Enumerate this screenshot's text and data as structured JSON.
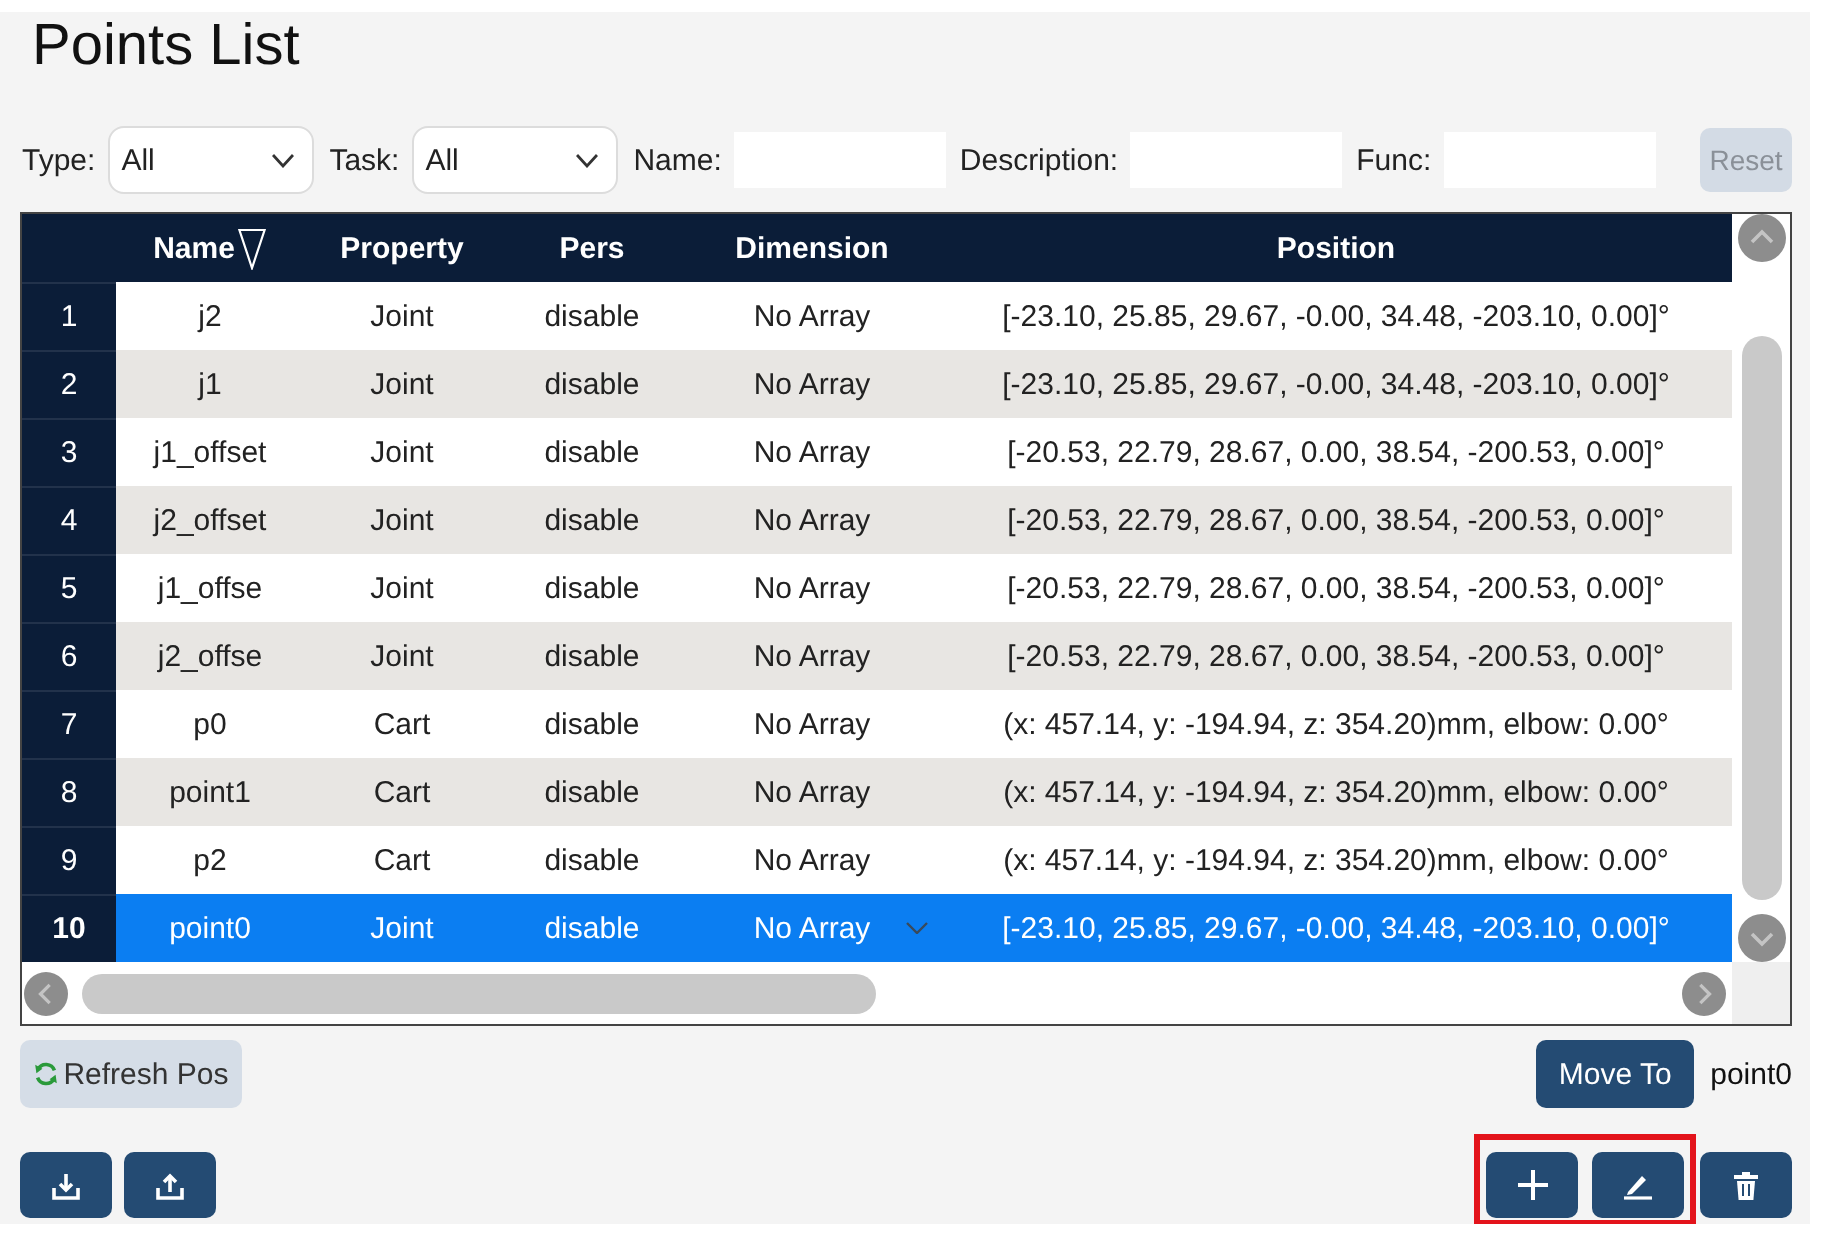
{
  "title": "Points List",
  "filters": [
    {
      "kind": "select",
      "label": "Type:",
      "value": "All"
    },
    {
      "kind": "select",
      "label": "Task:",
      "value": "All"
    },
    {
      "kind": "input",
      "label": "Name:"
    },
    {
      "kind": "input",
      "label": "Description:"
    },
    {
      "kind": "input",
      "label": "Func:"
    }
  ],
  "reset_button": {
    "label": "Reset",
    "disabled": true
  },
  "table": {
    "columns": [
      {
        "label": "Name",
        "sorted": true
      },
      {
        "label": "Property",
        "sorted": false
      },
      {
        "label": "Pers",
        "sorted": false
      },
      {
        "label": "Dimension",
        "sorted": false
      },
      {
        "label": "Position",
        "sorted": false
      }
    ],
    "rows": [
      {
        "index": "1",
        "cells": [
          "j2",
          "Joint",
          "disable",
          "No Array",
          "[-23.10, 25.85, 29.67, -0.00, 34.48, -203.10, 0.00]°"
        ],
        "selected": false
      },
      {
        "index": "2",
        "cells": [
          "j1",
          "Joint",
          "disable",
          "No Array",
          "[-23.10, 25.85, 29.67, -0.00, 34.48, -203.10, 0.00]°"
        ],
        "selected": false
      },
      {
        "index": "3",
        "cells": [
          "j1_offset",
          "Joint",
          "disable",
          "No Array",
          "[-20.53, 22.79, 28.67, 0.00, 38.54, -200.53, 0.00]°"
        ],
        "selected": false
      },
      {
        "index": "4",
        "cells": [
          "j2_offset",
          "Joint",
          "disable",
          "No Array",
          "[-20.53, 22.79, 28.67, 0.00, 38.54, -200.53, 0.00]°"
        ],
        "selected": false
      },
      {
        "index": "5",
        "cells": [
          "j1_offse",
          "Joint",
          "disable",
          "No Array",
          "[-20.53, 22.79, 28.67, 0.00, 38.54, -200.53, 0.00]°"
        ],
        "selected": false
      },
      {
        "index": "6",
        "cells": [
          "j2_offse",
          "Joint",
          "disable",
          "No Array",
          "[-20.53, 22.79, 28.67, 0.00, 38.54, -200.53, 0.00]°"
        ],
        "selected": false
      },
      {
        "index": "7",
        "cells": [
          "p0",
          "Cart",
          "disable",
          "No Array",
          "(x: 457.14, y: -194.94, z: 354.20)mm, elbow: 0.00°"
        ],
        "selected": false
      },
      {
        "index": "8",
        "cells": [
          "point1",
          "Cart",
          "disable",
          "No Array",
          "(x: 457.14, y: -194.94, z: 354.20)mm, elbow: 0.00°"
        ],
        "selected": false
      },
      {
        "index": "9",
        "cells": [
          "p2",
          "Cart",
          "disable",
          "No Array",
          "(x: 457.14, y: -194.94, z: 354.20)mm, elbow: 0.00°"
        ],
        "selected": false
      },
      {
        "index": "10",
        "cells": [
          "point0",
          "Joint",
          "disable",
          "No Array",
          "[-23.10, 25.85, 29.67, -0.00, 34.48, -203.10, 0.00]°"
        ],
        "selected": true
      }
    ]
  },
  "refresh_button": {
    "label": "Refresh Pos"
  },
  "move_to": {
    "label": "Move To",
    "target": "point0"
  },
  "file_buttons": [
    {
      "kind": "download"
    },
    {
      "kind": "upload"
    }
  ],
  "edit_buttons": [
    {
      "kind": "add",
      "highlighted": true
    },
    {
      "kind": "edit",
      "highlighted": true
    },
    {
      "kind": "delete",
      "highlighted": false
    }
  ]
}
